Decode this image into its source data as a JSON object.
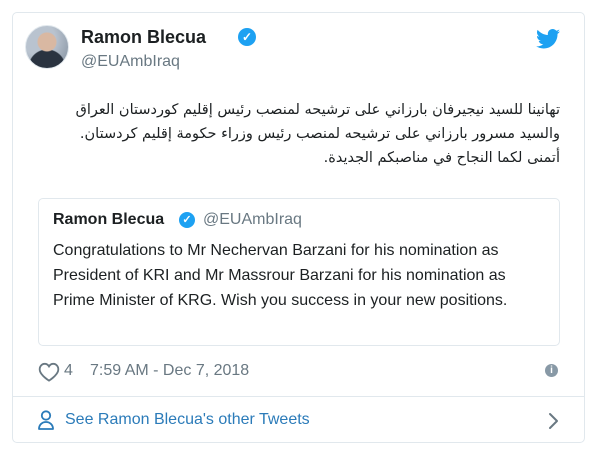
{
  "tweet": {
    "author_name": "Ramon Blecua",
    "author_handle": "@EUAmbIraq",
    "verified_glyph": "✓",
    "text_lines": [
      "تهانينا للسيد نيجيرفان بارزاني على ترشيحه لمنصب رئيس إقليم كوردستان العراق",
      "والسيد مسرور بارزاني على ترشيحه لمنصب رئيس وزراء حكومة إقليم كردستان.",
      "أتمنى لكما النجاح في مناصبكم الجديدة."
    ],
    "quoted": {
      "author_name": "Ramon Blecua",
      "author_handle": "@EUAmbIraq",
      "text": "Congratulations to  Mr Nechervan Barzani for his nomination as President of KRI and Mr Massrour Barzani for his nomination as Prime Minister of KRG. Wish you success in your new positions."
    },
    "likes": "4",
    "timestamp": "7:59 AM - Dec 7, 2018",
    "info_glyph": "i"
  },
  "footer": {
    "see_more_label": "See Ramon Blecua's other Tweets"
  },
  "icons": {
    "bird": "twitter-bird-icon",
    "heart": "heart-icon",
    "info": "info-icon",
    "person": "person-icon",
    "chevron": "chevron-right-icon"
  },
  "colors": {
    "link": "#2b7bb9",
    "verified": "#1da1f2",
    "muted": "#697882",
    "border": "#e1e8ed"
  }
}
